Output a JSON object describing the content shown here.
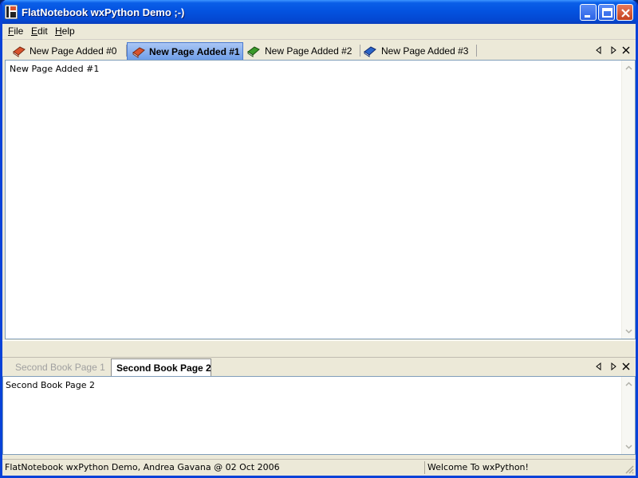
{
  "window": {
    "title": "FlatNotebook wxPython Demo ;-)"
  },
  "menu": [
    {
      "label": "File",
      "key": "F",
      "rest": "ile"
    },
    {
      "label": "Edit",
      "key": "E",
      "rest": "dit"
    },
    {
      "label": "Help",
      "key": "H",
      "rest": "elp"
    }
  ],
  "book1": {
    "tabs": [
      {
        "label": "New Page Added #0",
        "icon": "red-book-icon",
        "color": "#d9532e",
        "state": "normal"
      },
      {
        "label": "New Page Added #1",
        "icon": "red-book-icon",
        "color": "#d9532e",
        "state": "active"
      },
      {
        "label": "New Page Added #2",
        "icon": "green-book-icon",
        "color": "#3a9a2a",
        "state": "normal"
      },
      {
        "label": "New Page Added #3",
        "icon": "blue-book-icon",
        "color": "#2a64c8",
        "state": "normal"
      }
    ],
    "content": "New Page Added #1"
  },
  "book2": {
    "tabs": [
      {
        "label": "Second Book Page 1",
        "state": "disabled"
      },
      {
        "label": "Second Book Page 2",
        "state": "active"
      }
    ],
    "content": "Second Book Page 2"
  },
  "status": {
    "left": "FlatNotebook wxPython Demo, Andrea Gavana @ 02 Oct 2006",
    "right": "Welcome To wxPython!"
  },
  "colors": {
    "titlebar": "#0453e0",
    "active_tab": "#6e9ee8",
    "window_bg": "#ece9d8"
  }
}
